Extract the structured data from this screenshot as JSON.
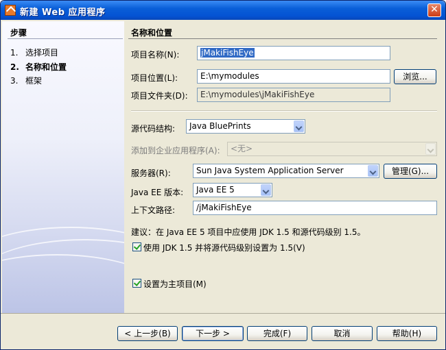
{
  "window": {
    "title": "新建 Web 应用程序",
    "close": "✕"
  },
  "steps": {
    "title": "步骤",
    "items": [
      {
        "num": "1.",
        "label": "选择项目"
      },
      {
        "num": "2.",
        "label": "名称和位置"
      },
      {
        "num": "3.",
        "label": "框架"
      }
    ]
  },
  "panel": {
    "title": "名称和位置",
    "project_name_label": "项目名称(N):",
    "project_name_value": "jMakiFishEye",
    "project_location_label": "项目位置(L):",
    "project_location_value": "E:\\mymodules",
    "browse_button": "浏览...",
    "project_folder_label": "项目文件夹(D):",
    "project_folder_value": "E:\\mymodules\\jMakiFishEye",
    "source_structure_label": "源代码结构:",
    "source_structure_value": "Java BluePrints",
    "add_to_enterprise_label": "添加到企业应用程序(A):",
    "add_to_enterprise_value": "<无>",
    "server_label": "服务器(R):",
    "server_value": "Sun Java System Application Server",
    "manage_button": "管理(G)...",
    "javaee_version_label": "Java EE 版本:",
    "javaee_version_value": "Java EE 5",
    "context_path_label": "上下文路径:",
    "context_path_value": "/jMakiFishEye",
    "suggestion": "建议：在 Java EE 5 项目中应使用 JDK 1.5 和源代码级别 1.5。",
    "use_jdk_checkbox": "使用 JDK 1.5 并将源代码级别设置为 1.5(V)",
    "main_project_checkbox": "设置为主项目(M)"
  },
  "buttons": {
    "back": "< 上一步(B)",
    "next": "下一步 >",
    "finish": "完成(F)",
    "cancel": "取消",
    "help": "帮助(H)"
  }
}
